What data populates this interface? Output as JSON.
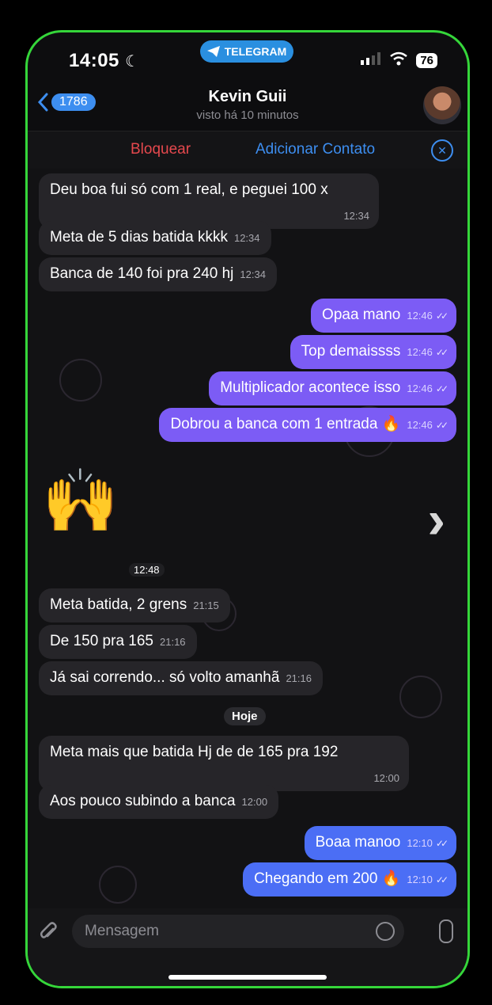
{
  "status": {
    "time": "14:05",
    "moon": "☾",
    "app_pill": "TELEGRAM",
    "battery": "76"
  },
  "header": {
    "back_count": "1786",
    "contact_name": "Kevin Guii",
    "last_seen": "visto há 10 minutos"
  },
  "actions": {
    "block": "Bloquear",
    "add_contact": "Adicionar Contato"
  },
  "messages": [
    {
      "text": "Deu boa fui só com 1 real, e peguei 100 x",
      "time": "12:34"
    },
    {
      "text": "Meta de 5 dias batida kkkk",
      "time": "12:34"
    },
    {
      "text": "Banca de 140 foi pra 240 hj",
      "time": "12:34"
    },
    {
      "text": "Opaa mano",
      "time": "12:46"
    },
    {
      "text": "Top demaissss",
      "time": "12:46"
    },
    {
      "text": "Multiplicador acontece isso",
      "time": "12:46"
    },
    {
      "text": "Dobrou a banca com 1 entrada 🔥",
      "time": "12:46"
    },
    {
      "text": "🙌",
      "time": "12:48"
    },
    {
      "text": "Meta batida, 2 grens",
      "time": "21:15"
    },
    {
      "text": "De 150 pra 165",
      "time": "21:16"
    },
    {
      "text": "Já sai correndo... só volto amanhã",
      "time": "21:16"
    },
    {
      "text": "Meta  mais que batida Hj de de 165 pra 192",
      "time": "12:00"
    },
    {
      "text": "Aos pouco subindo a banca",
      "time": "12:00"
    },
    {
      "text": "Boaa manoo",
      "time": "12:10"
    },
    {
      "text": "Chegando em 200 🔥",
      "time": "12:10"
    }
  ],
  "date_separator": "Hoje",
  "input": {
    "placeholder": "Mensagem"
  }
}
